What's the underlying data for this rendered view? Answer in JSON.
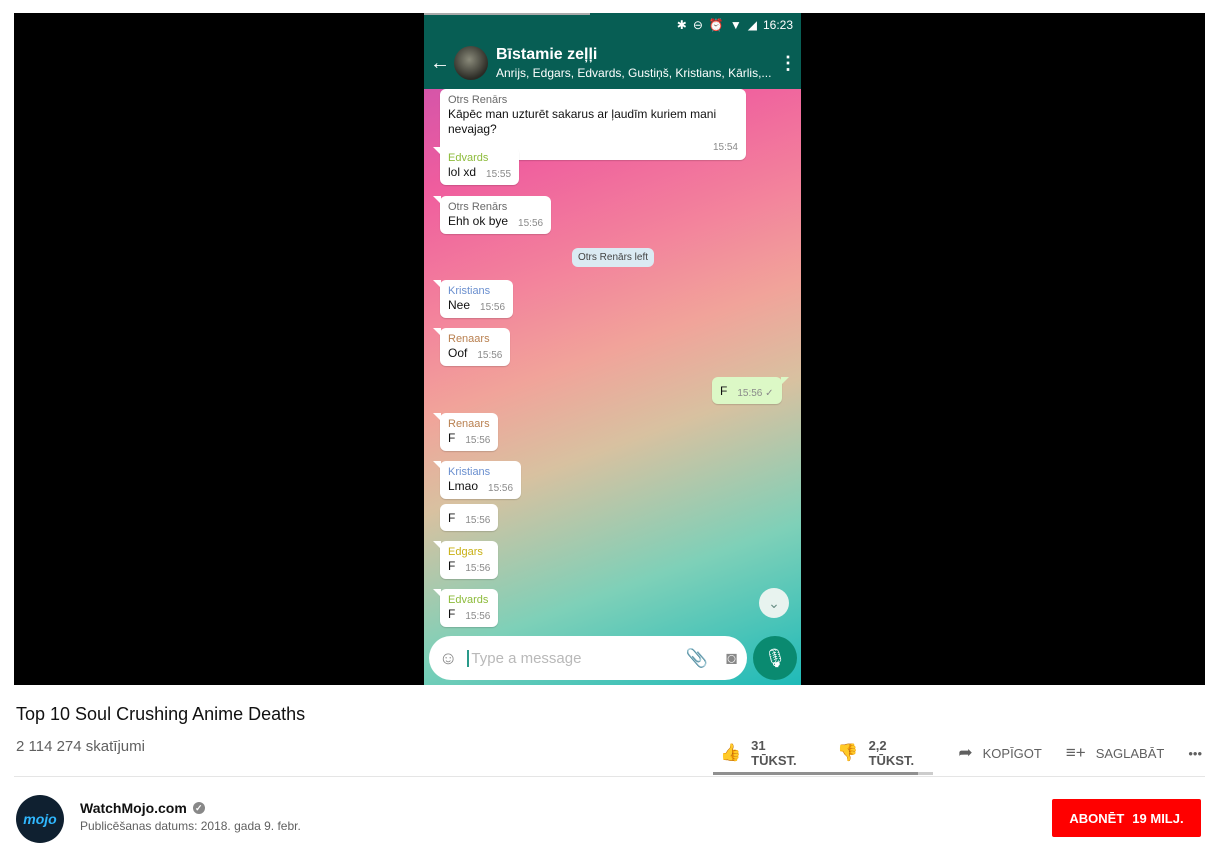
{
  "video": {
    "title": "Top 10 Soul Crushing Anime Deaths",
    "views": "2 114 274 skatījumi",
    "like_count": "31 TŪKST.",
    "dislike_count": "2,2 TŪKST.",
    "share_label": "KOPĪGOT",
    "save_label": "SAGLABĀT",
    "more_label": "•••",
    "like_ratio": 0.93
  },
  "channel": {
    "name": "WatchMojo.com",
    "avatar_text": "mojo",
    "published": "Publicēšanas datums: 2018. gada 9. febr.",
    "subscribe_label": "ABONĒT",
    "subscriber_count": "19 MILJ."
  },
  "phone": {
    "status_time": "16:23",
    "chat_title": "Bīstamie zeļļi",
    "chat_members": "Anrijs, Edgars, Edvards, Gustiņš, Kristians, Kārlis,...",
    "system_message": "Otrs Renārs left",
    "composer_placeholder": "Type a message",
    "messages": [
      {
        "sender": "Otrs Renārs",
        "text": "Kāpēc man uzturēt sakarus ar ļaudīm kuriem mani nevajag?",
        "time": "15:54",
        "sender_color": "#6a6a6a"
      },
      {
        "sender": "Edvards",
        "text": "lol xd",
        "time": "15:55",
        "sender_color": "#8dbb3b"
      },
      {
        "sender": "Otrs Renārs",
        "text": "Ehh ok bye",
        "time": "15:56",
        "sender_color": "#6a6a6a"
      },
      {
        "sender": "Kristians",
        "text": "Nee",
        "time": "15:56",
        "sender_color": "#6a8fcf"
      },
      {
        "sender": "Renaars",
        "text": "Oof",
        "time": "15:56",
        "sender_color": "#b98050"
      },
      {
        "sender": "",
        "text": "F",
        "time": "15:56 ✓",
        "outgoing": true
      },
      {
        "sender": "Renaars",
        "text": "F",
        "time": "15:56",
        "sender_color": "#b98050"
      },
      {
        "sender": "Kristians",
        "text": "Lmao",
        "time": "15:56",
        "sender_color": "#6a8fcf"
      },
      {
        "sender": "",
        "text": "F",
        "time": "15:56"
      },
      {
        "sender": "Edgars",
        "text": "F",
        "time": "15:56",
        "sender_color": "#c8b014"
      },
      {
        "sender": "Edvards",
        "text": "F",
        "time": "15:56",
        "sender_color": "#8dbb3b"
      }
    ]
  },
  "colors": {
    "whatsapp_green": "#075e54",
    "subscribe_red": "#ff0000"
  }
}
